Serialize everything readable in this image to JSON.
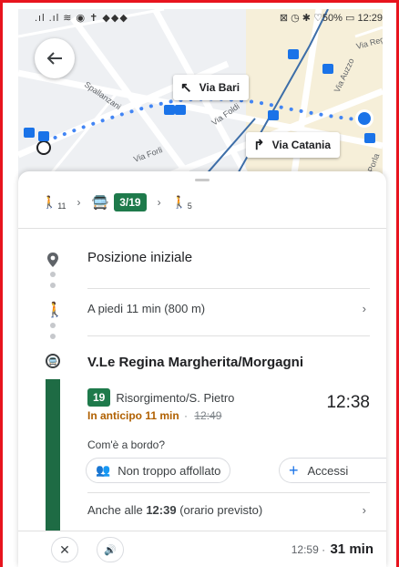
{
  "status_bar": {
    "left_icons": ".ıl .ıl ≋ ◉ ✝ ◆◆◆",
    "right": "⊠ ◷ ✱ ♡50% ▭ 12:29"
  },
  "map": {
    "street_labels": [
      "Spallanzani",
      "Via Reg",
      "Via Foldi",
      "Via Forli",
      "Via Porla",
      "Via Auzzo"
    ],
    "turn_bari": "Via Bari",
    "turn_catania": "Via Catania"
  },
  "summary": {
    "walk_start_min": "11",
    "bus_line": "3/19",
    "walk_end_min": "5"
  },
  "steps": {
    "start": "Posizione iniziale",
    "walk": "A piedi 11 min (800 m)",
    "stop": "V.Le Regina Margherita/Morgagni",
    "route_line": "19",
    "route_dest": "Risorgimento/S. Pietro",
    "early_text": "In anticipo 11 min",
    "scheduled": "12:49",
    "departure": "12:38",
    "onboard_question": "Com'è a bordo?",
    "chip_crowd": "Non troppo affollato",
    "chip_access": "Accessi",
    "also_prefix": "Anche alle ",
    "also_time": "12:39",
    "also_suffix": " (orario previsto)"
  },
  "bottom": {
    "arrival": "12:59",
    "duration": "31 min"
  },
  "colors": {
    "transit_green": "#1e7a4b",
    "route_blue": "#1a73e8",
    "early_orange": "#b06000",
    "frame_red": "#e8141e"
  }
}
